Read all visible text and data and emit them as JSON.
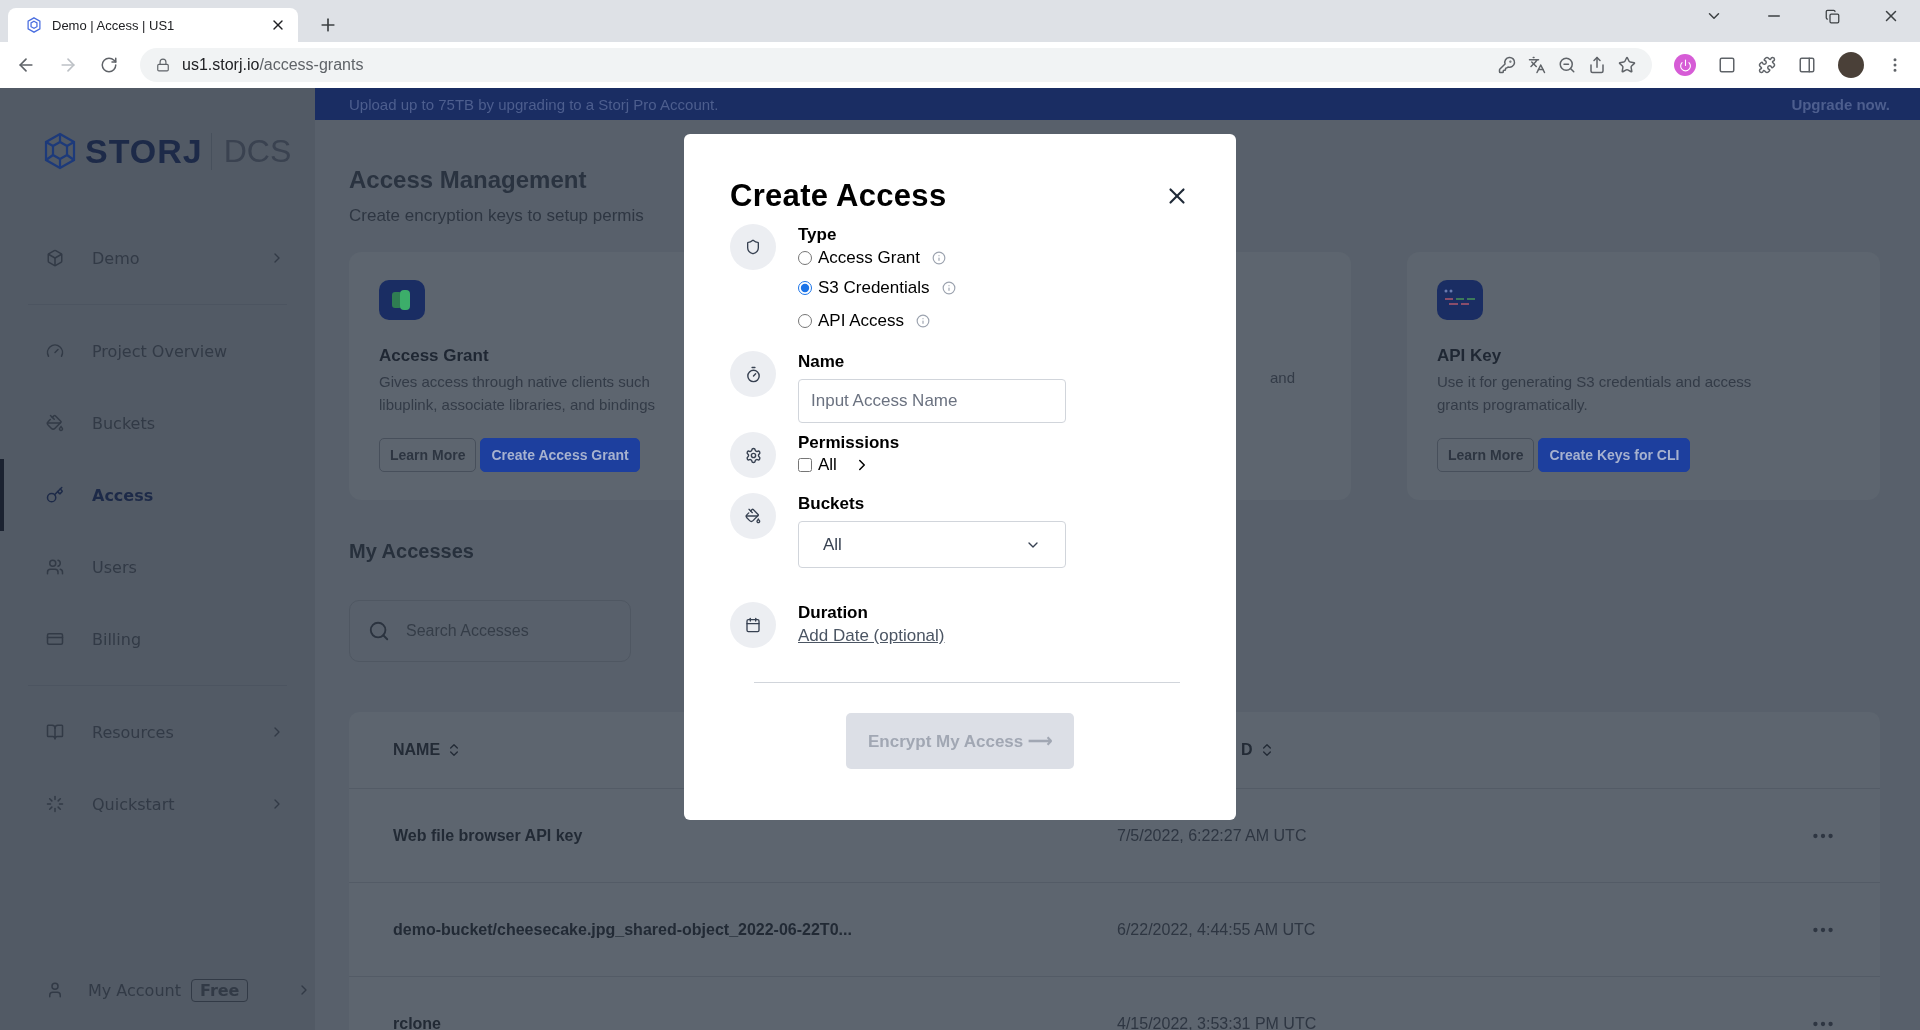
{
  "browser": {
    "tab_title": "Demo | Access | US1",
    "url_host": "us1.storj.io",
    "url_path": "/access-grants"
  },
  "banner": {
    "text": "Upload up to 75TB by upgrading to a Storj Pro Account.",
    "link": "Upgrade now."
  },
  "sidebar": {
    "logo": {
      "brand": "STORJ",
      "product": "DCS"
    },
    "items": [
      {
        "label": "Demo",
        "selected": false,
        "expandable": true,
        "divider_after": true
      },
      {
        "label": "Project Overview",
        "selected": false,
        "expandable": false,
        "divider_after": false
      },
      {
        "label": "Buckets",
        "selected": false,
        "expandable": false,
        "divider_after": false
      },
      {
        "label": "Access",
        "selected": true,
        "expandable": false,
        "divider_after": false
      },
      {
        "label": "Users",
        "selected": false,
        "expandable": false,
        "divider_after": false
      },
      {
        "label": "Billing",
        "selected": false,
        "expandable": false,
        "divider_after": true
      },
      {
        "label": "Resources",
        "selected": false,
        "expandable": true,
        "divider_after": false
      },
      {
        "label": "Quickstart",
        "selected": false,
        "expandable": true,
        "divider_after": false
      }
    ],
    "account": {
      "label": "My Account",
      "badge": "Free"
    }
  },
  "page": {
    "title": "Access Management",
    "subtitle": "Create encryption keys to setup permis",
    "cards": [
      {
        "title": "Access Grant",
        "lines": [
          "Gives access through native clients such",
          "libuplink, associate libraries, and bindings"
        ],
        "buttons": [
          "Learn More",
          "Create Access Grant"
        ]
      },
      {
        "lines": [
          "and"
        ]
      },
      {
        "title": "API Key",
        "lines": [
          "Use it for generating S3 credentials and access",
          "grants programatically."
        ],
        "buttons": [
          "Learn More",
          "Create Keys for CLI"
        ]
      }
    ],
    "section_title": "My Accesses",
    "search": {
      "placeholder": "Search Accesses"
    },
    "table": {
      "columns": [
        "NAME",
        "D"
      ],
      "rows": [
        {
          "name": "Web file browser API key",
          "date": "7/5/2022, 6:22:27 AM UTC"
        },
        {
          "name": "demo-bucket/cheesecake.jpg_shared-object_2022-06-22T0...",
          "date": "6/22/2022, 4:44:55 AM UTC"
        },
        {
          "name": "rclone",
          "date": "4/15/2022, 3:53:31 PM UTC"
        }
      ]
    }
  },
  "dialog": {
    "title": "Create Access",
    "type": {
      "label": "Type",
      "options": [
        {
          "label": "Access Grant",
          "selected": false
        },
        {
          "label": "S3 Credentials",
          "selected": true
        },
        {
          "label": "API Access",
          "selected": false
        }
      ]
    },
    "name": {
      "label": "Name",
      "placeholder": "Input Access Name"
    },
    "permissions": {
      "label": "Permissions",
      "option": "All",
      "checked": false
    },
    "buckets": {
      "label": "Buckets",
      "value": "All"
    },
    "duration": {
      "label": "Duration",
      "link": "Add Date (optional)"
    },
    "submit": {
      "label": "Encrypt My Access ⟶",
      "disabled": true
    }
  }
}
